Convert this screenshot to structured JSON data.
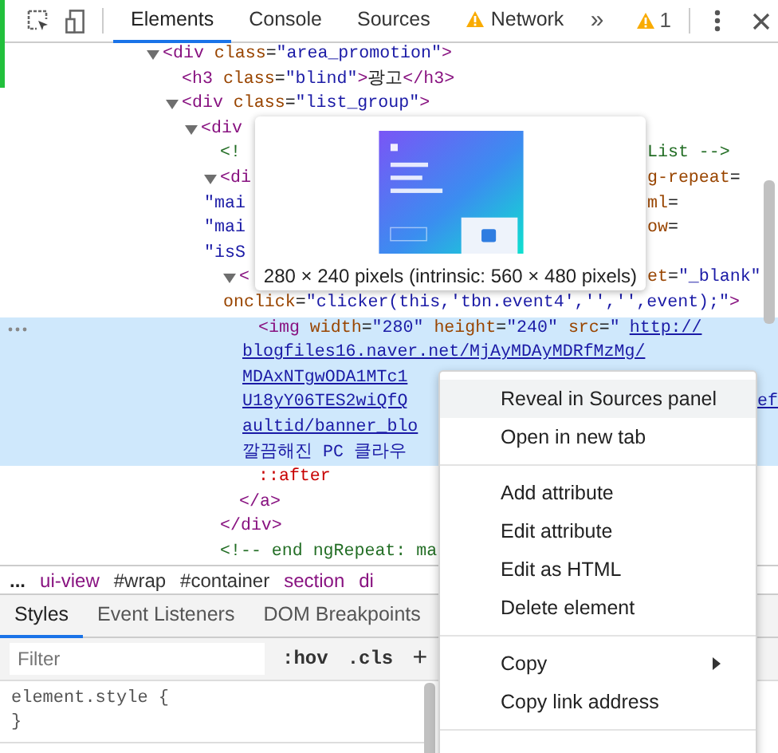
{
  "toolbar": {
    "tabs": [
      {
        "label": "Elements",
        "selected": true,
        "warning": false
      },
      {
        "label": "Console",
        "selected": false,
        "warning": false
      },
      {
        "label": "Sources",
        "selected": false,
        "warning": false
      },
      {
        "label": "Network",
        "selected": false,
        "warning": true
      }
    ],
    "overflow": "»",
    "warning_count": "1"
  },
  "dom_tree": [
    {
      "expanded": true,
      "selected": false,
      "lines": [
        {
          "kind": "code",
          "code": "<div class=\"area_promotion\">"
        }
      ],
      "children": [
        {
          "selected": false,
          "lines": [
            {
              "kind": "code",
              "code": "<h3 class=\"blind\">광고</h3>"
            }
          ]
        },
        {
          "expanded": true,
          "selected": false,
          "lines": [
            {
              "kind": "code",
              "code": "<div class=\"list_group\">"
            }
          ],
          "children": [
            {
              "expanded": true,
              "selected": false,
              "lines": [
                {
                  "kind": "code",
                  "code": "<div"
                }
              ],
              "children": [
                {
                  "selected": false,
                  "lines": [
                    {
                      "kind": "comment",
                      "code": "<!",
                      "tail": "List -->"
                    }
                  ]
                },
                {
                  "expanded": true,
                  "selected": false,
                  "close": "</div>",
                  "lines": [
                    {
                      "kind": "code",
                      "code": "<di",
                      "tail": "g-repeat="
                    },
                    {
                      "kind": "code",
                      "code": "\"mai",
                      "tail": "ml="
                    },
                    {
                      "kind": "code",
                      "code": "\"mai",
                      "tail": "ow="
                    },
                    {
                      "kind": "code",
                      "code": "\"isS"
                    }
                  ],
                  "children": [
                    {
                      "expanded": true,
                      "selected": false,
                      "close": "</a>",
                      "lines": [
                        {
                          "kind": "code",
                          "code": "<",
                          "tail": "et=\"_blank\""
                        },
                        {
                          "kind": "code",
                          "code": "onclick=\"clicker(this,'tbn.event4','','',event);\">"
                        }
                      ],
                      "children": [
                        {
                          "selected": true,
                          "lines": [
                            {
                              "kind": "code",
                              "code": "<img width=\"280\" height=\"240\" src=\"",
                              "link": "http://"
                            },
                            {
                              "kind": "link",
                              "code": "blogfiles16.naver.net/MjAyMDAyMDRfMzMg/"
                            },
                            {
                              "kind": "link",
                              "code": "MDAxNTgwODA1MTc1"
                            },
                            {
                              "kind": "link",
                              "code": "U18yY06TES2wiQfQ",
                              "tail": "ef"
                            },
                            {
                              "kind": "link",
                              "code": "aultid/banner_blo"
                            },
                            {
                              "kind": "value",
                              "code": "깔끔해진 PC 클라우"
                            }
                          ]
                        },
                        {
                          "selected": false,
                          "lines": [
                            {
                              "kind": "pseudo",
                              "code": "::after"
                            }
                          ]
                        }
                      ]
                    }
                  ]
                },
                {
                  "selected": false,
                  "lines": [
                    {
                      "kind": "comment",
                      "code": "<!-- end ngRepeat: ma"
                    }
                  ]
                }
              ]
            }
          ]
        }
      ]
    }
  ],
  "image_tooltip": {
    "caption": "280 × 240 pixels (intrinsic: 560 × 480 pixels)"
  },
  "breadcrumbs": [
    {
      "label": "...",
      "kind": "more"
    },
    {
      "label": "ui-view",
      "kind": "tag"
    },
    {
      "label": "#wrap",
      "kind": "id"
    },
    {
      "label": "#container",
      "kind": "id"
    },
    {
      "label": "section",
      "kind": "tag"
    },
    {
      "label": "di",
      "kind": "tag"
    }
  ],
  "sidebar_tabs": [
    {
      "label": "Styles",
      "selected": true
    },
    {
      "label": "Event Listeners",
      "selected": false
    },
    {
      "label": "DOM Breakpoints",
      "selected": false
    }
  ],
  "filter": {
    "placeholder": "Filter"
  },
  "filter_buttons": [
    ":hov",
    ".cls",
    "+"
  ],
  "style_rules": [
    {
      "lines": [
        "element.style {",
        "}"
      ]
    }
  ],
  "context_menu": [
    [
      {
        "label": "Reveal in Sources panel",
        "selected": true,
        "submenu": false
      },
      {
        "label": "Open in new tab",
        "selected": false,
        "submenu": false
      }
    ],
    [
      {
        "label": "Add attribute",
        "selected": false,
        "submenu": false
      },
      {
        "label": "Edit attribute",
        "selected": false,
        "submenu": false
      },
      {
        "label": "Edit as HTML",
        "selected": false,
        "submenu": false
      },
      {
        "label": "Delete element",
        "selected": false,
        "submenu": false
      }
    ],
    [
      {
        "label": "Copy",
        "selected": false,
        "submenu": true
      },
      {
        "label": "Copy link address",
        "selected": false,
        "submenu": false
      }
    ]
  ]
}
